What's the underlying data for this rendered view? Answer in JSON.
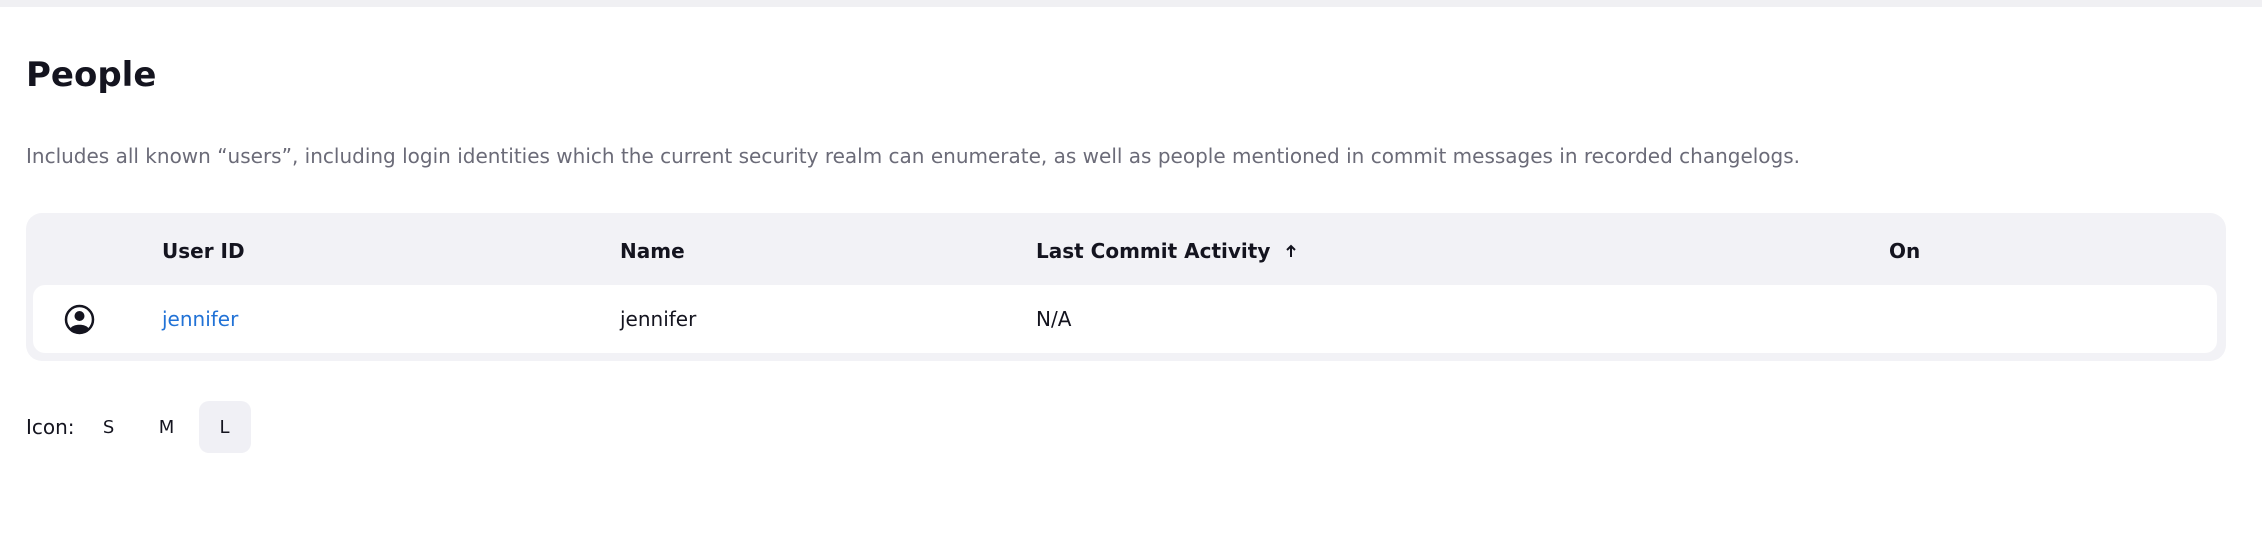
{
  "page": {
    "title": "People",
    "description": "Includes all known “users”, including login identities which the current security realm can enumerate, as well as people mentioned in commit messages in recorded changelogs."
  },
  "table": {
    "columns": {
      "user_id": "User ID",
      "name": "Name",
      "last_commit": "Last Commit Activity",
      "on": "On"
    },
    "sort_icon": "arrow-up-icon",
    "rows": [
      {
        "icon": "user-circle-icon",
        "user_id": "jennifer",
        "name": "jennifer",
        "last_commit": "N/A",
        "on": ""
      }
    ]
  },
  "icon_size": {
    "label": "Icon:",
    "options": [
      "S",
      "M",
      "L"
    ],
    "selected": "L"
  },
  "colors": {
    "link": "#2172d6",
    "table_bg": "#f2f2f6",
    "muted_text": "#6b6b78"
  }
}
